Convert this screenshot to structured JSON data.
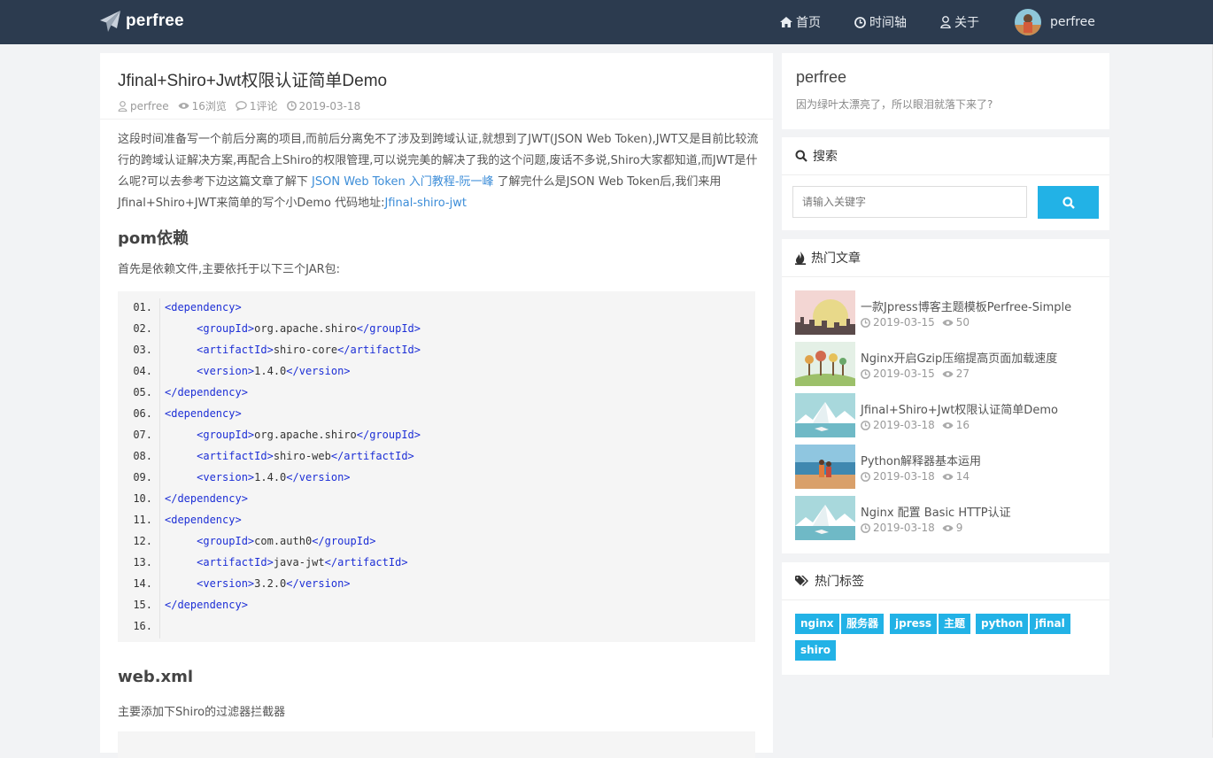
{
  "nav": {
    "brand": "perfree",
    "items": [
      {
        "label": "首页",
        "icon": "home-icon"
      },
      {
        "label": "时间轴",
        "icon": "clock-icon"
      },
      {
        "label": "关于",
        "icon": "user-icon"
      }
    ],
    "user": "perfree"
  },
  "post": {
    "title": "Jfinal+Shiro+Jwt权限认证简单Demo",
    "meta": {
      "author": "perfree",
      "views": "16浏览",
      "comments": "1评论",
      "date": "2019-03-18"
    },
    "intro": {
      "text1": "这段时间准备写一个前后分离的项目,而前后分离免不了涉及到跨域认证,就想到了JWT(JSON Web Token),JWT又是目前比较流行的跨域认证解决方案,再配合上Shiro的权限管理,可以说完美的解决了我的这个问题,废话不多说,Shiro大家都知道,而JWT是什么呢?可以去参考下边这篇文章了解下 ",
      "link1": "JSON Web Token 入门教程-阮一峰",
      "text2": " 了解完什么是JSON Web Token后,我们来用Jfinal+Shiro+JWT来简单的写个小Demo 代码地址:",
      "link2": "Jfinal-shiro-jwt"
    },
    "h_pom": "pom依赖",
    "p_dep": "首先是依赖文件,主要依托于以下三个JAR包:",
    "code_lines": [
      {
        "no": "01.",
        "indent": "",
        "tag": "dependency",
        "value": "",
        "self": "open"
      },
      {
        "no": "02.",
        "indent": "    ",
        "tag": "groupId",
        "value": "org.apache.shiro",
        "self": "full"
      },
      {
        "no": "03.",
        "indent": "    ",
        "tag": "artifactId",
        "value": "shiro-core",
        "self": "full"
      },
      {
        "no": "04.",
        "indent": "    ",
        "tag": "version",
        "value": "1.4.0",
        "self": "full"
      },
      {
        "no": "05.",
        "indent": "",
        "tag": "dependency",
        "value": "",
        "self": "close"
      },
      {
        "no": "06.",
        "indent": "",
        "tag": "dependency",
        "value": "",
        "self": "open"
      },
      {
        "no": "07.",
        "indent": "    ",
        "tag": "groupId",
        "value": "org.apache.shiro",
        "self": "full"
      },
      {
        "no": "08.",
        "indent": "    ",
        "tag": "artifactId",
        "value": "shiro-web",
        "self": "full"
      },
      {
        "no": "09.",
        "indent": "    ",
        "tag": "version",
        "value": "1.4.0",
        "self": "full"
      },
      {
        "no": "10.",
        "indent": "",
        "tag": "dependency",
        "value": "",
        "self": "close"
      },
      {
        "no": "11.",
        "indent": "",
        "tag": "dependency",
        "value": "",
        "self": "open"
      },
      {
        "no": "12.",
        "indent": "    ",
        "tag": "groupId",
        "value": "com.auth0",
        "self": "full"
      },
      {
        "no": "13.",
        "indent": "    ",
        "tag": "artifactId",
        "value": "java-jwt",
        "self": "full"
      },
      {
        "no": "14.",
        "indent": "    ",
        "tag": "version",
        "value": "3.2.0",
        "self": "full"
      },
      {
        "no": "15.",
        "indent": "",
        "tag": "dependency",
        "value": "",
        "self": "close"
      },
      {
        "no": "16.",
        "indent": "",
        "tag": "",
        "value": "",
        "self": "empty"
      }
    ],
    "h_web": "web.xml",
    "p_web": "主要添加下Shiro的过滤器拦截器"
  },
  "sidebar": {
    "profile": {
      "name": "perfree",
      "desc": "因为绿叶太漂亮了，所以眼泪就落下来了?"
    },
    "search": {
      "title": "搜索",
      "placeholder": "请输入关键字"
    },
    "hot": {
      "title": "热门文章",
      "items": [
        {
          "title": "一款Jpress博客主题模板Perfree-Simple",
          "date": "2019-03-15",
          "views": "50",
          "thumb": "sunset-city"
        },
        {
          "title": "Nginx开启Gzip压缩提高页面加载速度",
          "date": "2019-03-15",
          "views": "27",
          "thumb": "green-trees"
        },
        {
          "title": "Jfinal+Shiro+Jwt权限认证简单Demo",
          "date": "2019-03-18",
          "views": "16",
          "thumb": "snow-mountain"
        },
        {
          "title": "Python解释器基本运用",
          "date": "2019-03-18",
          "views": "14",
          "thumb": "beach-people"
        },
        {
          "title": "Nginx 配置 Basic HTTP认证",
          "date": "2019-03-18",
          "views": "9",
          "thumb": "snow-mountain"
        }
      ]
    },
    "tags": {
      "title": "热门标签",
      "items": [
        "nginx",
        "服务器",
        "jpress",
        "主题",
        "python",
        "jfinal",
        "shiro"
      ]
    }
  },
  "colors": {
    "nav_bg": "#2c3b4f",
    "accent": "#22b2e6",
    "link": "#3c8dd8",
    "code_tag": "#1d2fd6"
  }
}
